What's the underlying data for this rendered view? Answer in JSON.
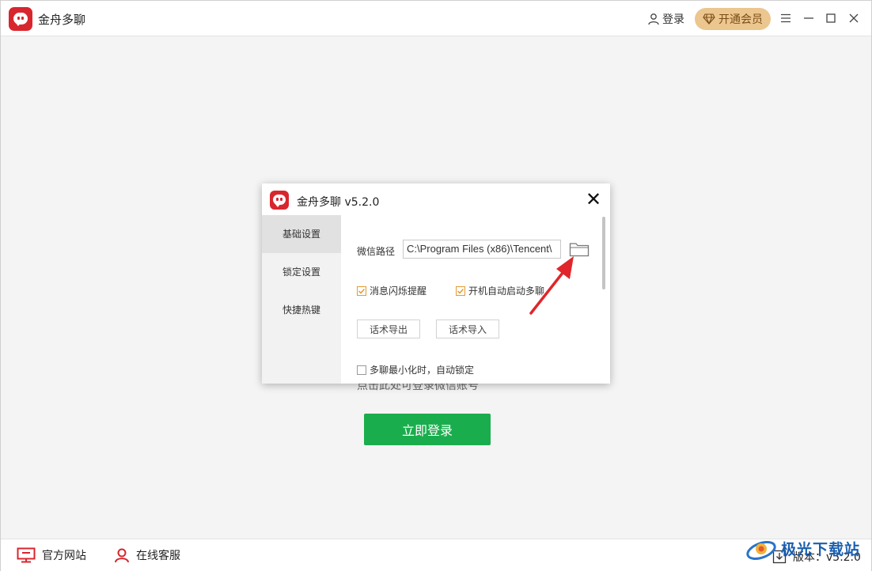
{
  "app": {
    "title": "金舟多聊",
    "login_label": "登录",
    "vip_label": "开通会员"
  },
  "main": {
    "hint_text": "点击此处可登录微信账号",
    "login_now_label": "立即登录"
  },
  "bottom": {
    "official_site_label": "官方网站",
    "online_service_label": "在线客服",
    "version_label": "版本：v5.2.0"
  },
  "watermark": {
    "text": "极光下载站"
  },
  "dialog": {
    "title": "金舟多聊 v5.2.0",
    "close_glyph": "✕",
    "sidebar": {
      "items": [
        {
          "label": "基础设置",
          "active": true
        },
        {
          "label": "锁定设置",
          "active": false
        },
        {
          "label": "快捷热键",
          "active": false
        }
      ]
    },
    "settings": {
      "path_label": "微信路径",
      "path_value": "C:\\Program Files (x86)\\Tencent\\",
      "flash_reminder_label": "消息闪烁提醒",
      "flash_reminder_checked": true,
      "autostart_label": "开机自动启动多聊",
      "autostart_checked": true,
      "export_label": "话术导出",
      "import_label": "话术导入",
      "minimize_lock_label": "多聊最小化时，自动锁定",
      "minimize_lock_checked": false
    }
  },
  "colors": {
    "brand_red": "#d8262e",
    "vip_gold": "#ecc68f",
    "login_green": "#1aad4d",
    "checkbox_orange": "#e39a32",
    "annotation_red": "#e0262b"
  }
}
